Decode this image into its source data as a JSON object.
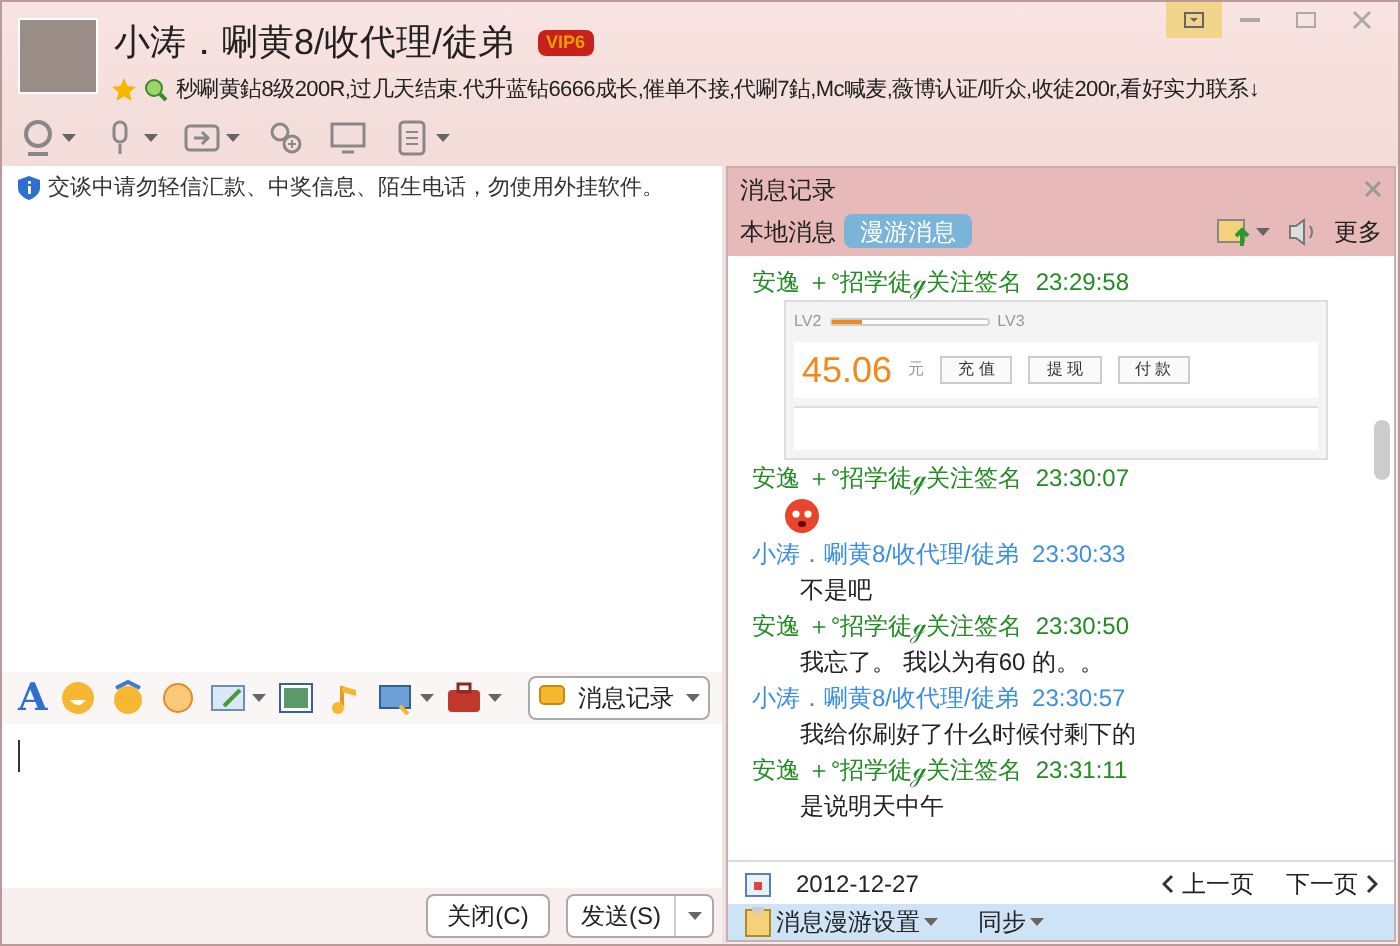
{
  "window": {
    "contact_name": "小涛．唰黄8/收代理/徒弟",
    "vip_badge": "VIP6",
    "signature": "秒唰黄鉆8级200R,过几天结束.代升蓝钻6666成长,催单不接,代唰7鉆,Mc喊麦,薇博认证/听众,收徒200r,看好实力联系↓"
  },
  "notice": "交谈中请勿轻信汇款、中奖信息、陌生电话，勿使用外挂软件。",
  "input_toolbar": {
    "font_icon": "A",
    "history_button": "消息记录"
  },
  "buttons": [
    {
      "label": "关闭(C)"
    },
    {
      "label": "发送(S)"
    }
  ],
  "history": {
    "title": "消息记录",
    "tabs": [
      {
        "label": "本地消息",
        "selected": false
      },
      {
        "label": "漫游消息",
        "selected": true
      }
    ],
    "more": "更多",
    "messages": [
      {
        "sender": "安逸 ＋°招学徒ℊ关注签名",
        "time": "23:29:58",
        "color": "#228b22",
        "kind": "screenshot",
        "shot": {
          "lv_from": "LV2",
          "lv_to": "LV3",
          "balance": "45.06",
          "unit": "元",
          "buttons": [
            "充 值",
            "提 现",
            "付 款"
          ]
        }
      },
      {
        "sender": "安逸 ＋°招学徒ℊ关注签名",
        "time": "23:30:07",
        "color": "#228b22",
        "kind": "emoji"
      },
      {
        "sender": "小涛．唰黄8/收代理/徒弟",
        "time": "23:30:33",
        "color": "#3a8ee6",
        "kind": "text",
        "text": "不是吧"
      },
      {
        "sender": "安逸 ＋°招学徒ℊ关注签名",
        "time": "23:30:50",
        "color": "#228b22",
        "kind": "text",
        "text": "我忘了。 我以为有60 的。。"
      },
      {
        "sender": "小涛．唰黄8/收代理/徒弟",
        "time": "23:30:57",
        "color": "#3a8ee6",
        "kind": "text",
        "text": "我给你刷好了什么时候付剩下的"
      },
      {
        "sender": "安逸 ＋°招学徒ℊ关注签名",
        "time": "23:31:11",
        "color": "#228b22",
        "kind": "text",
        "text": "是说明天中午"
      }
    ],
    "date": "2012-12-27",
    "prev": "上一页",
    "next": "下一页",
    "footer": [
      "消息漫游设置",
      "同步"
    ]
  }
}
